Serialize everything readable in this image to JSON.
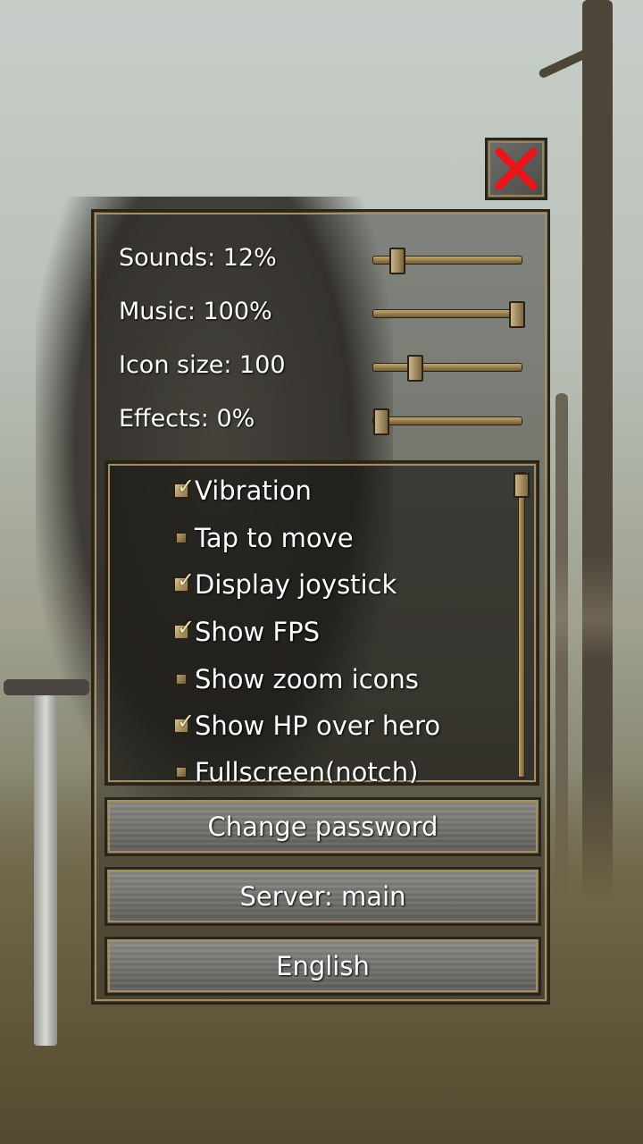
{
  "settings": {
    "sliders": [
      {
        "label": "Sounds: 12%",
        "value": 0.12
      },
      {
        "label": "Music: 100%",
        "value": 1.0
      },
      {
        "label": "Icon size: 100",
        "value": 0.25
      },
      {
        "label": "Effects: 0%",
        "value": 0.0
      }
    ],
    "options": [
      {
        "label": "Vibration",
        "checked": true
      },
      {
        "label": "Tap to move",
        "checked": false
      },
      {
        "label": "Display joystick",
        "checked": true
      },
      {
        "label": "Show FPS",
        "checked": true
      },
      {
        "label": "Show zoom icons",
        "checked": false
      },
      {
        "label": "Show HP over hero",
        "checked": true
      },
      {
        "label": "Fullscreen(notch)",
        "checked": false
      }
    ],
    "buttons": {
      "change_password": "Change password",
      "server": "Server: main",
      "language": "English"
    }
  },
  "colors": {
    "close_x": "#e8161b",
    "frame_gold": "#a48d5e",
    "text": "#ffffff"
  },
  "icons": {
    "close": "close-icon",
    "check": "check-icon"
  }
}
